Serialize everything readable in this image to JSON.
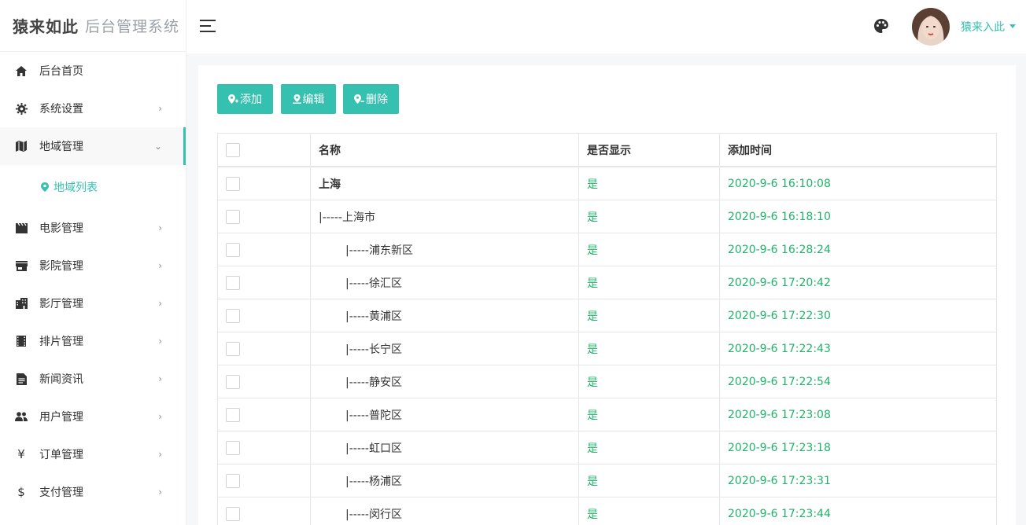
{
  "brand": {
    "logo": "猿来如此",
    "title": "后台管理系统"
  },
  "sidebar": {
    "items": [
      {
        "label": "后台首页",
        "icon": "home-icon"
      },
      {
        "label": "系统设置",
        "icon": "gear-icon"
      },
      {
        "label": "地域管理",
        "icon": "map-icon"
      },
      {
        "label": "电影管理",
        "icon": "film-icon"
      },
      {
        "label": "影院管理",
        "icon": "store-icon"
      },
      {
        "label": "影厅管理",
        "icon": "building-icon"
      },
      {
        "label": "排片管理",
        "icon": "film-strip-icon"
      },
      {
        "label": "新闻资讯",
        "icon": "news-icon"
      },
      {
        "label": "用户管理",
        "icon": "users-icon"
      },
      {
        "label": "订单管理",
        "icon": "yen-icon"
      },
      {
        "label": "支付管理",
        "icon": "dollar-icon"
      }
    ],
    "sub_item": {
      "label": "地域列表",
      "icon": "location-pin-icon"
    },
    "arrow_collapsed": "›",
    "arrow_expanded": "⌄"
  },
  "header": {
    "username": "猿来入此"
  },
  "toolbar": {
    "add_label": "添加",
    "edit_label": "编辑",
    "delete_label": "删除"
  },
  "table": {
    "headers": [
      "名称",
      "是否显示",
      "添加时间"
    ],
    "rows": [
      {
        "name": "上海",
        "shown": "是",
        "time": "2020-9-6 16:10:08"
      },
      {
        "name": "|-----上海市",
        "shown": "是",
        "time": "2020-9-6 16:18:10"
      },
      {
        "name": "|-----浦东新区",
        "shown": "是",
        "time": "2020-9-6 16:28:24"
      },
      {
        "name": "|-----徐汇区",
        "shown": "是",
        "time": "2020-9-6 17:20:42"
      },
      {
        "name": "|-----黄浦区",
        "shown": "是",
        "time": "2020-9-6 17:22:30"
      },
      {
        "name": "|-----长宁区",
        "shown": "是",
        "time": "2020-9-6 17:22:43"
      },
      {
        "name": "|-----静安区",
        "shown": "是",
        "time": "2020-9-6 17:22:54"
      },
      {
        "name": "|-----普陀区",
        "shown": "是",
        "time": "2020-9-6 17:23:08"
      },
      {
        "name": "|-----虹口区",
        "shown": "是",
        "time": "2020-9-6 17:23:18"
      },
      {
        "name": "|-----杨浦区",
        "shown": "是",
        "time": "2020-9-6 17:23:31"
      },
      {
        "name": "|-----闵行区",
        "shown": "是",
        "time": "2020-9-6 17:23:44"
      }
    ]
  },
  "colors": {
    "accent": "#35c0b0",
    "green_text": "#20b36a"
  }
}
